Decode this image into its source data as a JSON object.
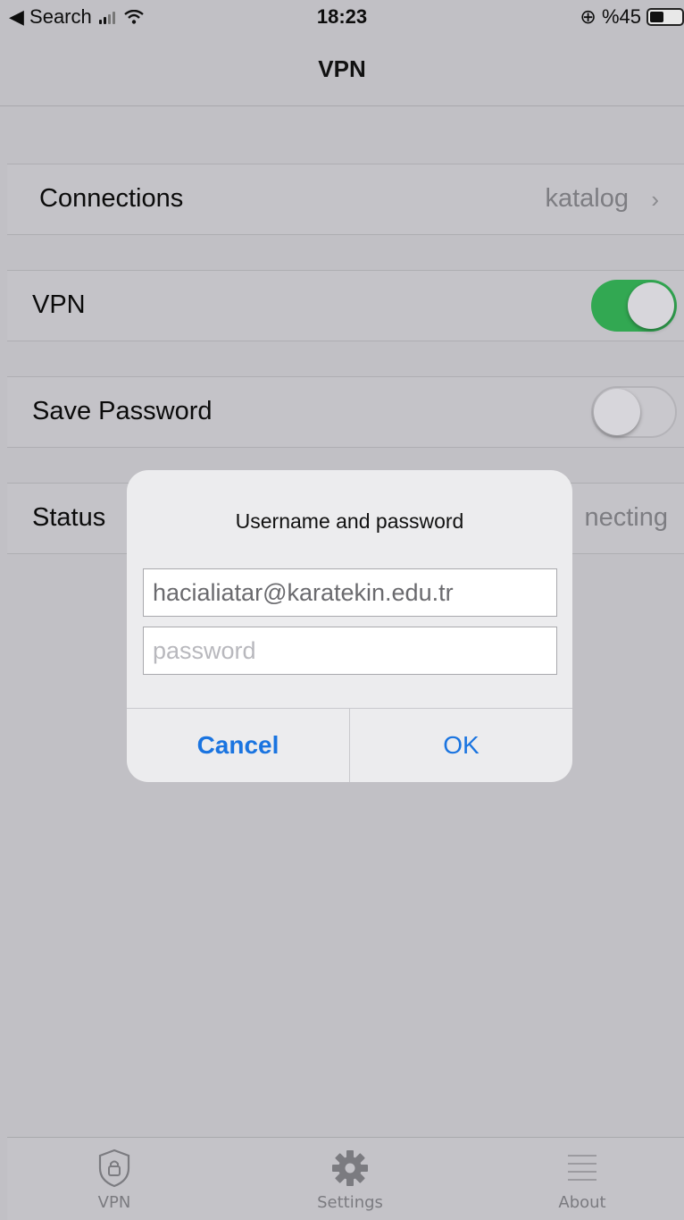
{
  "status_bar": {
    "back_label": "◀ Search",
    "time": "18:23",
    "battery_label": "⊕ %45",
    "battery_level": 0.45
  },
  "nav": {
    "title": "VPN"
  },
  "rows": {
    "connections": {
      "label": "Connections",
      "value": "katalog",
      "chevron": "›"
    },
    "vpn": {
      "label": "VPN",
      "toggle_on": true
    },
    "save_password": {
      "label": "Save Password",
      "toggle_on": false
    },
    "status": {
      "label": "Status",
      "value": "necting"
    }
  },
  "dialog": {
    "title": "Username and password",
    "username_value": "hacialiatar@karatekin.edu.tr",
    "password_placeholder": "password",
    "cancel_label": "Cancel",
    "ok_label": "OK"
  },
  "tabs": [
    {
      "label": "VPN",
      "icon": "shield-lock-icon"
    },
    {
      "label": "Settings",
      "icon": "gear-icon"
    },
    {
      "label": "About",
      "icon": "list-icon"
    }
  ],
  "colors": {
    "accent_blue": "#1a74e0",
    "toggle_green": "#32a852",
    "background": "#c1c0c5"
  }
}
